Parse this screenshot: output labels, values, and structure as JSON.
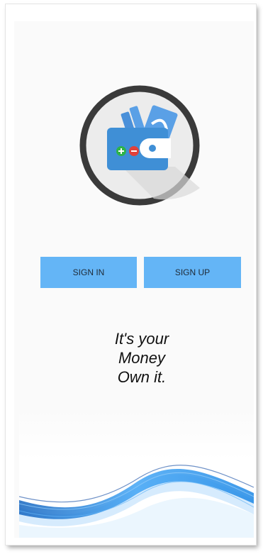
{
  "app": {
    "logo_icon": "wallet-icon",
    "colors": {
      "button_bg": "#64b5f6",
      "logo_ring": "#3a3a3a",
      "wallet_blue": "#3f8fd6",
      "plus_green": "#2db34a",
      "minus_red": "#e0413a",
      "wave_blue": "#1e88e5"
    }
  },
  "auth": {
    "signin_label": "SIGN IN",
    "signup_label": "SIGN UP"
  },
  "tagline": {
    "line1": "It's your",
    "line2": "Money",
    "line3": "Own it."
  }
}
